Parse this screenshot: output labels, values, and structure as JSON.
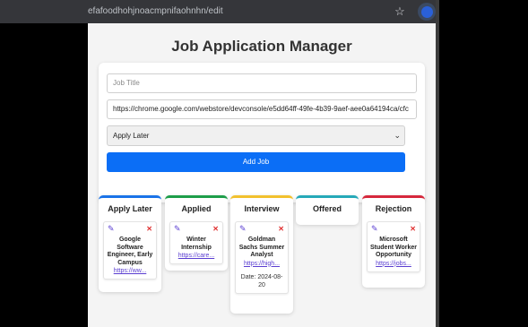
{
  "browser": {
    "url": "efafoodhohjnoacmpnifaohnhn/edit"
  },
  "app": {
    "title": "Job Application Manager"
  },
  "form": {
    "title_placeholder": "Job Title",
    "url_value": "https://chrome.google.com/webstore/devconsole/e5dd64ff-49fe-4b39-9aef-aee0a64194ca/cfc",
    "status_selected": "Apply Later",
    "add_label": "Add Job"
  },
  "columns": [
    {
      "title": "Apply Later",
      "color": "#1a73e8",
      "jobs": [
        {
          "title": "Google Software Engineer, Early Campus",
          "link": "https://ww...",
          "date": ""
        }
      ]
    },
    {
      "title": "Applied",
      "color": "#1e9e4a",
      "jobs": [
        {
          "title": "Winter Internship",
          "link": "https://care...",
          "date": ""
        }
      ]
    },
    {
      "title": "Interview",
      "color": "#f2c12e",
      "jobs": [
        {
          "title": "Goldman Sachs Summer Analyst",
          "link": "https://high...",
          "date": "Date: 2024-08-20"
        }
      ]
    },
    {
      "title": "Offered",
      "color": "#26a9b8",
      "jobs": []
    },
    {
      "title": "Rejection",
      "color": "#d6283c",
      "jobs": [
        {
          "title": "Microsoft Student Worker Opportunity",
          "link": "https://jobs...",
          "date": ""
        }
      ]
    }
  ],
  "icons": {
    "edit": "pencil-icon",
    "delete": "x-icon",
    "bookmark": "star-icon"
  }
}
